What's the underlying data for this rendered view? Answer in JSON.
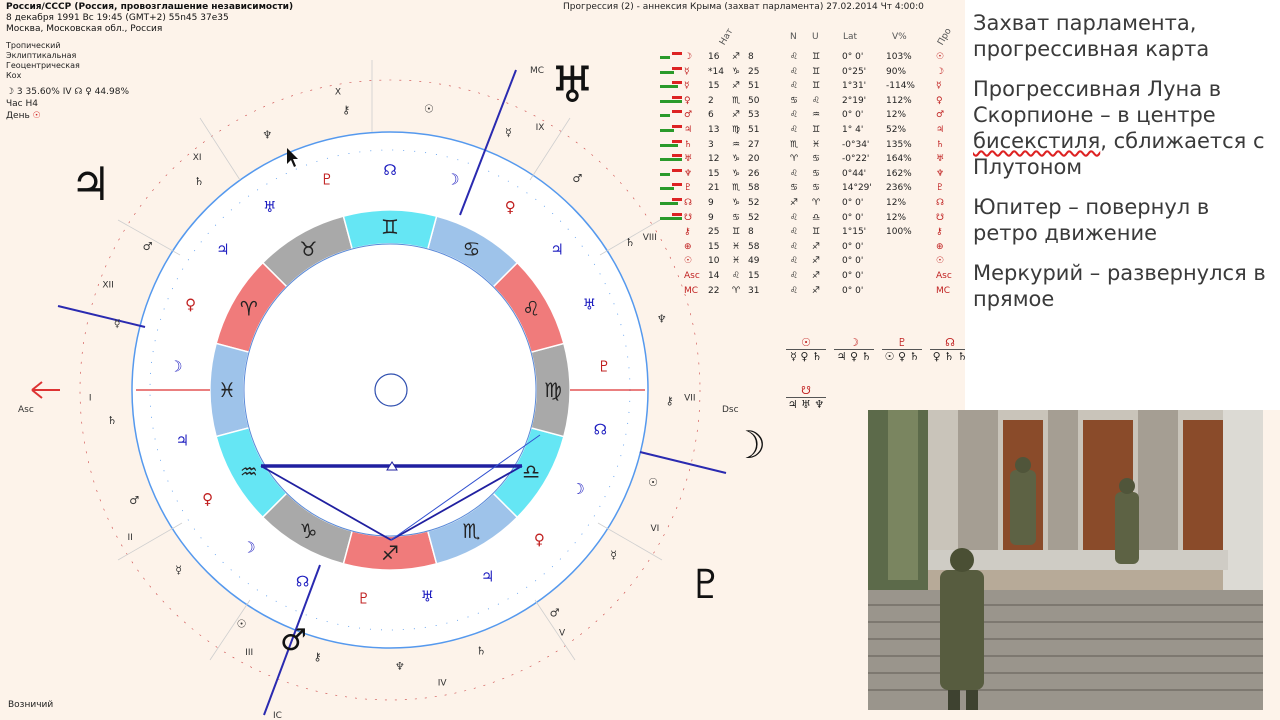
{
  "header": {
    "left_title": "Россия/СССР (Россия, провозглашение независимости)",
    "left_line2": "8 декабря 1991  Вс  19:45 (GMT+2) 55n45  37e35",
    "left_line3": "Москва, Московская обл., Россия",
    "right_title": "Прогрессия (2) - аннексия Крыма (захват парламента) 27.02.2014  Чт  4:00:0"
  },
  "chart_settings": [
    "Тропический",
    "Эклиптикальная",
    "Геоцентрическая",
    "Кох"
  ],
  "moon_phase": "☽  3 35.60% IV  ☊ ♀ 44.98%",
  "hour_line": "Час H4",
  "day_line": "День",
  "bottom_left": "Возничий",
  "notes": {
    "n1": "Захват парламента, прогрессивная карта",
    "n2_a": "Прогрессивная Луна в Скорпионе – в центре ",
    "n2_wavy": "бисекстиля",
    "n2_b": ", сближается с Плутоном",
    "n3": "Юпитер – повернул в ретро движение",
    "n4": "Меркурий – развернулся в прямое"
  },
  "table": {
    "headers": [
      "Нат",
      "N",
      "U",
      "Lat",
      "V%",
      "Про"
    ],
    "rows": [
      {
        "g": "☽",
        "deg": "16",
        "sign": "♐",
        "min": "8",
        "n": "♌",
        "u": "♊",
        "lat": "0° 0'",
        "v": "103%",
        "pr": "☉",
        "c": "#d00"
      },
      {
        "g": "☿",
        "deg": "*14",
        "sign": "♑",
        "min": "25",
        "n": "♌",
        "u": "♊",
        "lat": "0°25'",
        "v": "90%",
        "pr": "☽",
        "c": "#222"
      },
      {
        "g": "☿",
        "deg": "15",
        "sign": "♐",
        "min": "51",
        "n": "♌",
        "u": "♊",
        "lat": "1°31'",
        "v": "-114%",
        "pr": "☿",
        "c": "#222"
      },
      {
        "g": "♀",
        "deg": "2",
        "sign": "♏",
        "min": "50",
        "n": "♋",
        "u": "♌",
        "lat": "2°19'",
        "v": "112%",
        "pr": "♀",
        "c": "#222"
      },
      {
        "g": "♂",
        "deg": "6",
        "sign": "♐",
        "min": "53",
        "n": "♌",
        "u": "♒",
        "lat": "0° 0'",
        "v": "12%",
        "pr": "♂",
        "c": "#222"
      },
      {
        "g": "♃",
        "deg": "13",
        "sign": "♍",
        "min": "51",
        "n": "♌",
        "u": "♊",
        "lat": "1° 4'",
        "v": "52%",
        "pr": "♃",
        "c": "#222"
      },
      {
        "g": "♄",
        "deg": "3",
        "sign": "♒",
        "min": "27",
        "n": "♏",
        "u": "♓",
        "lat": "-0°34'",
        "v": "135%",
        "pr": "♄",
        "c": "#222"
      },
      {
        "g": "♅",
        "deg": "12",
        "sign": "♑",
        "min": "20",
        "n": "♈",
        "u": "♋",
        "lat": "-0°22'",
        "v": "164%",
        "pr": "♅",
        "c": "#222"
      },
      {
        "g": "♆",
        "deg": "15",
        "sign": "♑",
        "min": "26",
        "n": "♌",
        "u": "♋",
        "lat": "0°44'",
        "v": "162%",
        "pr": "♆",
        "c": "#222"
      },
      {
        "g": "♇",
        "deg": "21",
        "sign": "♏",
        "min": "58",
        "n": "♋",
        "u": "♋",
        "lat": "14°29'",
        "v": "236%",
        "pr": "♇",
        "c": "#222"
      },
      {
        "g": "☊",
        "deg": "9",
        "sign": "♑",
        "min": "52",
        "n": "♐",
        "u": "♈",
        "lat": "0° 0'",
        "v": "12%",
        "pr": "☊",
        "c": "#222"
      },
      {
        "g": "☋",
        "deg": "9",
        "sign": "♋",
        "min": "52",
        "n": "♌",
        "u": "♎",
        "lat": "0° 0'",
        "v": "12%",
        "pr": "☋",
        "c": "#222"
      },
      {
        "g": "⚷",
        "deg": "25",
        "sign": "♊",
        "min": "8",
        "n": "♌",
        "u": "♊",
        "lat": "1°15'",
        "v": "100%",
        "pr": "⚷",
        "c": "#222"
      },
      {
        "g": "⊕",
        "deg": "15",
        "sign": "♓",
        "min": "58",
        "n": "♌",
        "u": "♐",
        "lat": "0° 0'",
        "v": "",
        "pr": "⊕",
        "c": "#222"
      },
      {
        "g": "☉",
        "deg": "10",
        "sign": "♓",
        "min": "49",
        "n": "♌",
        "u": "♐",
        "lat": "0° 0'",
        "v": "",
        "pr": "☉",
        "c": "#222"
      },
      {
        "g": "Asc",
        "deg": "14",
        "sign": "♌",
        "min": "15",
        "n": "♌",
        "u": "♐",
        "lat": "0° 0'",
        "v": "",
        "pr": "Asc",
        "c": "#222"
      },
      {
        "g": "MC",
        "deg": "22",
        "sign": "♈",
        "min": "31",
        "n": "♌",
        "u": "♐",
        "lat": "0° 0'",
        "v": "",
        "pr": "MC",
        "c": "#222"
      }
    ]
  },
  "aspect_blocks": [
    {
      "top": "☉",
      "bottom": "☿ ♀ ♄"
    },
    {
      "top": "☽",
      "bottom": "♃ ♀ ♄"
    },
    {
      "top": "♇",
      "bottom": "☉ ♀ ♄"
    },
    {
      "top": "☊",
      "bottom": "♀ ♄ ♄"
    },
    {
      "top": "☋",
      "bottom": "♃ ♅ ♆"
    }
  ],
  "chart": {
    "mc_label": "MC",
    "ic_label": "IC",
    "asc_label": "Asc",
    "dsc_label": "Dsc",
    "house_labels": [
      "X",
      "XI",
      "XII",
      "I",
      "II",
      "III",
      "IV",
      "V",
      "VI",
      "VII",
      "VIII",
      "IX"
    ],
    "zodiac": [
      "♉",
      "♈",
      "♓",
      "♒",
      "♑",
      "♐",
      "♏",
      "♎",
      "♍",
      "♌",
      "♋",
      "♊"
    ],
    "big_glyphs": [
      "♃",
      "♅",
      "☽",
      "♇",
      "♂"
    ]
  },
  "colors": {
    "fire": "#f07b7b",
    "earth": "#a9a9a9",
    "air": "#65e6f4",
    "water": "#9ec3ea",
    "ring": "#5599ee"
  }
}
